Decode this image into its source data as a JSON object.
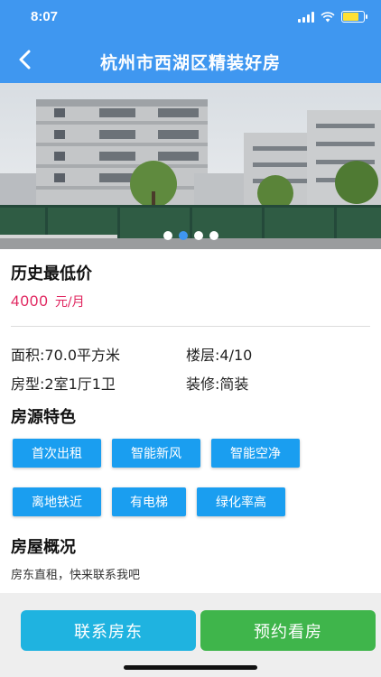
{
  "status_bar": {
    "time": "8:07",
    "icons": [
      "signal-icon",
      "wifi-icon",
      "battery-icon"
    ],
    "battery_level": 0.75
  },
  "nav": {
    "title": "杭州市西湖区精装好房",
    "back_icon": "chevron-left-icon"
  },
  "carousel": {
    "count": 4,
    "active_index": 1
  },
  "price": {
    "heading": "历史最低价",
    "amount": "4000",
    "unit": "元/月"
  },
  "details": {
    "area": "面积:70.0平方米",
    "floor": "楼层:4/10",
    "layout": "房型:2室1厅1卫",
    "decoration": "装修:简装"
  },
  "features": {
    "heading": "房源特色",
    "tags": [
      "首次出租",
      "智能新风",
      "智能空净",
      "离地铁近",
      "有电梯",
      "绿化率高"
    ]
  },
  "overview": {
    "heading": "房屋概况",
    "text": "房东直租，快来联系我吧"
  },
  "actions": {
    "contact": "联系房东",
    "book": "预约看房"
  },
  "colors": {
    "primary": "#3f97f0",
    "price": "#e0245e",
    "tag": "#1a9ef0",
    "contact": "#1fb3e0",
    "book": "#3fb54b"
  }
}
